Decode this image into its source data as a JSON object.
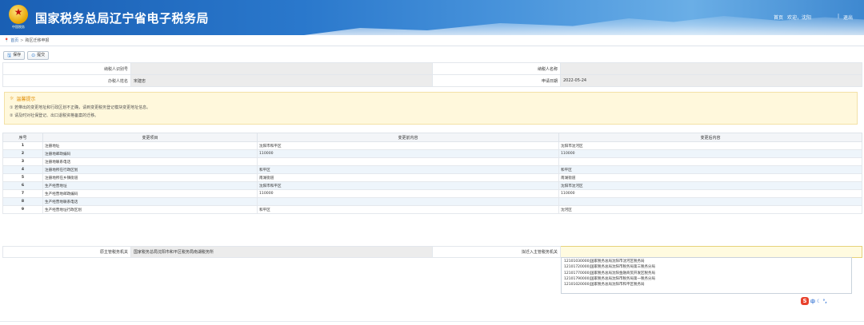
{
  "header": {
    "site_title": "国家税务总局辽宁省电子税务局",
    "emblem_text": "中国税务",
    "nav": {
      "home": "首页",
      "welcome": "欢迎，沈阳",
      "logout": "退出",
      "separator": "|"
    }
  },
  "breadcrumb": {
    "home": "首页",
    "separator": ">",
    "current": "跨区迁移申报"
  },
  "toolbar": {
    "save_label": "保存",
    "submit_label": "提交"
  },
  "info": {
    "taxpayer_id_label": "纳税人识别号",
    "taxpayer_id_value": "",
    "taxpayer_name_label": "纳税人名称",
    "taxpayer_name_value": "",
    "handler_label": "办税人姓名",
    "handler_value": "宋建忠",
    "apply_date_label": "申请日期",
    "apply_date_value": "2022-05-24"
  },
  "notice": {
    "title": "温馨提示",
    "line1": "① 若带出的变更地址和行政区划不正确，请到变更税务登记模块变更地址信息。",
    "line2": "② 请及时对社保登记、出口退税资格备案的迁移。"
  },
  "table": {
    "headers": [
      "序号",
      "变更项目",
      "变更前内容",
      "变更后内容"
    ],
    "rows": [
      {
        "no": "1",
        "item": "注册地址",
        "before": "沈阳市和平区",
        "after": "沈阳市沈河区"
      },
      {
        "no": "2",
        "item": "注册地邮政编码",
        "before": "110000",
        "after": "110000"
      },
      {
        "no": "3",
        "item": "注册地联系电话",
        "before": "",
        "after": ""
      },
      {
        "no": "4",
        "item": "注册地所在行政区划",
        "before": "和平区",
        "after": "和平区"
      },
      {
        "no": "5",
        "item": "注册地所在乡镇街道",
        "before": "南湖街道",
        "after": "南湖街道"
      },
      {
        "no": "6",
        "item": "生产经营地址",
        "before": "沈阳市和平区",
        "after": "沈阳市沈河区"
      },
      {
        "no": "7",
        "item": "生产经营地邮政编码",
        "before": "110000",
        "after": "110000"
      },
      {
        "no": "8",
        "item": "生产经营地联系电话",
        "before": "",
        "after": ""
      },
      {
        "no": "9",
        "item": "生产经营地址行政区划",
        "before": "和平区",
        "after": "沈河区"
      }
    ]
  },
  "tax_office": {
    "original_label": "原主管税务机关",
    "original_value": "国家税务总局沈阳市和平区税务局南湖税务所",
    "target_label": "拟迁入主管税务机关",
    "target_value": ""
  },
  "dropdown_options": [
    "12101030000|国家税务总局沈阳市沈河区税务局",
    "12101720000|国家税务总局沈阳市税务局第三税务分局",
    "12101770000|国家税务总局沈阳金融商贸开发区税务局",
    "12101790000|国家税务总局沈阳市税务局第一税务分局",
    "12101020000|国家税务总局沈阳市和平区税务局"
  ],
  "ime": {
    "logo": "S",
    "mode": "中"
  }
}
